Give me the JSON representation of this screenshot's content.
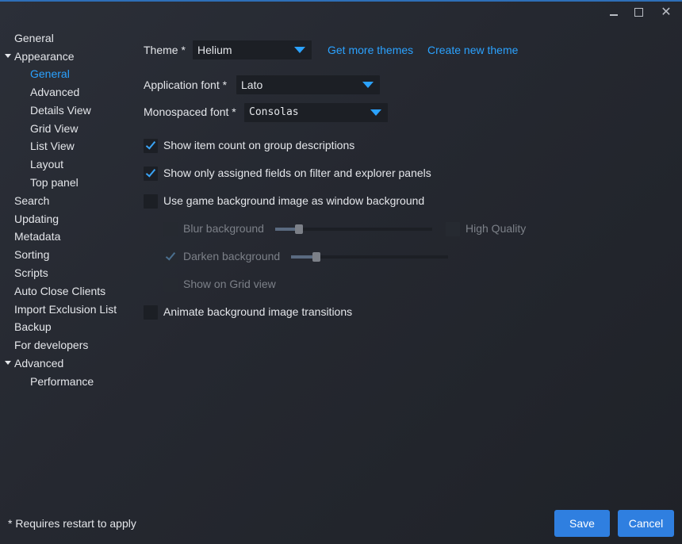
{
  "window": {
    "minimize_icon": "minimize-icon",
    "maximize_icon": "maximize-icon",
    "close_glyph": "✕"
  },
  "sidebar": {
    "items": [
      {
        "label": "General",
        "level": 0
      },
      {
        "label": "Appearance",
        "level": 0,
        "expanded": true
      },
      {
        "label": "General",
        "level": 1,
        "active": true
      },
      {
        "label": "Advanced",
        "level": 1
      },
      {
        "label": "Details View",
        "level": 1
      },
      {
        "label": "Grid View",
        "level": 1
      },
      {
        "label": "List View",
        "level": 1
      },
      {
        "label": "Layout",
        "level": 1
      },
      {
        "label": "Top panel",
        "level": 1
      },
      {
        "label": "Search",
        "level": 0
      },
      {
        "label": "Updating",
        "level": 0
      },
      {
        "label": "Metadata",
        "level": 0
      },
      {
        "label": "Sorting",
        "level": 0
      },
      {
        "label": "Scripts",
        "level": 0
      },
      {
        "label": "Auto Close Clients",
        "level": 0
      },
      {
        "label": "Import Exclusion List",
        "level": 0
      },
      {
        "label": "Backup",
        "level": 0
      },
      {
        "label": "For developers",
        "level": 0
      },
      {
        "label": "Advanced",
        "level": 0,
        "expanded": true
      },
      {
        "label": "Performance",
        "level": 1
      }
    ]
  },
  "main": {
    "theme": {
      "label": "Theme *",
      "value": "Helium",
      "get_more": "Get more themes",
      "create_new": "Create new theme"
    },
    "app_font": {
      "label": "Application font *",
      "value": "Lato"
    },
    "mono_font": {
      "label": "Monospaced font *",
      "value": "Consolas"
    },
    "options": {
      "show_count": {
        "label": "Show item count on group descriptions",
        "checked": true
      },
      "show_assigned": {
        "label": "Show only assigned fields on filter and explorer panels",
        "checked": true
      },
      "game_bg": {
        "label": "Use game background image as window background",
        "checked": false
      },
      "blur": {
        "label": "Blur background",
        "checked": false,
        "level": 0.15
      },
      "high_quality": {
        "label": "High Quality",
        "checked": false
      },
      "darken": {
        "label": "Darken background",
        "checked": true,
        "level": 0.16
      },
      "show_grid": {
        "label": "Show on Grid view",
        "checked": false
      },
      "animate": {
        "label": "Animate background image transitions",
        "checked": false
      }
    }
  },
  "footer": {
    "note": "* Requires restart to apply",
    "save": "Save",
    "cancel": "Cancel"
  },
  "colors": {
    "accent": "#2ba2ff",
    "button": "#2f7fe0",
    "background": "#252830"
  }
}
